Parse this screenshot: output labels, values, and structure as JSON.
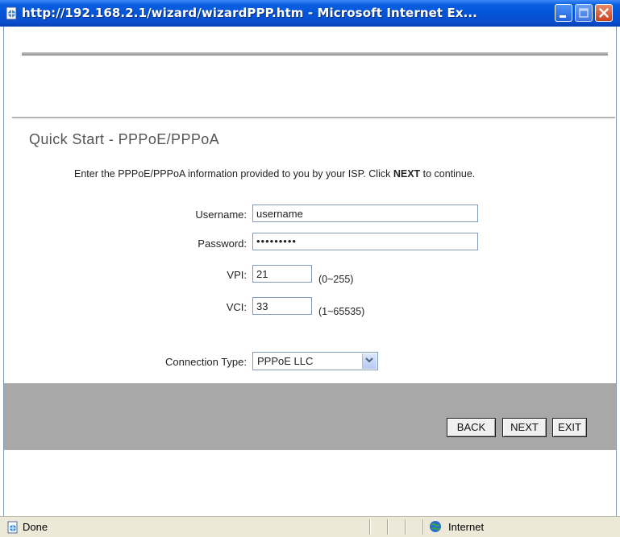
{
  "window": {
    "title": "http://192.168.2.1/wizard/wizardPPP.htm - Microsoft Internet Ex...",
    "title_bar_color": "#0a5fe0"
  },
  "page": {
    "title": "Quick Start - PPPoE/PPPoA",
    "instructions_before": "Enter the PPPoE/PPPoA information provided to you by your ISP. Click ",
    "instructions_emphasis": "NEXT",
    "instructions_after": " to continue."
  },
  "form": {
    "username": {
      "label": "Username:",
      "value": "username"
    },
    "password": {
      "label": "Password:",
      "value": "•••••••••"
    },
    "vpi": {
      "label": "VPI:",
      "value": "21",
      "hint": "(0~255)"
    },
    "vci": {
      "label": "VCI:",
      "value": "33",
      "hint": "(1~65535)"
    },
    "connection_type": {
      "label": "Connection Type:",
      "selected": "PPPoE LLC"
    }
  },
  "buttons": {
    "back": "BACK",
    "next": "NEXT",
    "exit": "EXIT",
    "bar_color": "#a8a8a8"
  },
  "statusbar": {
    "status": "Done",
    "zone": "Internet"
  },
  "icons": {
    "app": "ie-page-icon",
    "minimize": "minimize-icon",
    "maximize": "maximize-icon",
    "close": "close-icon",
    "status": "page-done-icon",
    "zone": "internet-globe-icon",
    "dropdown": "chevron-down-icon"
  }
}
